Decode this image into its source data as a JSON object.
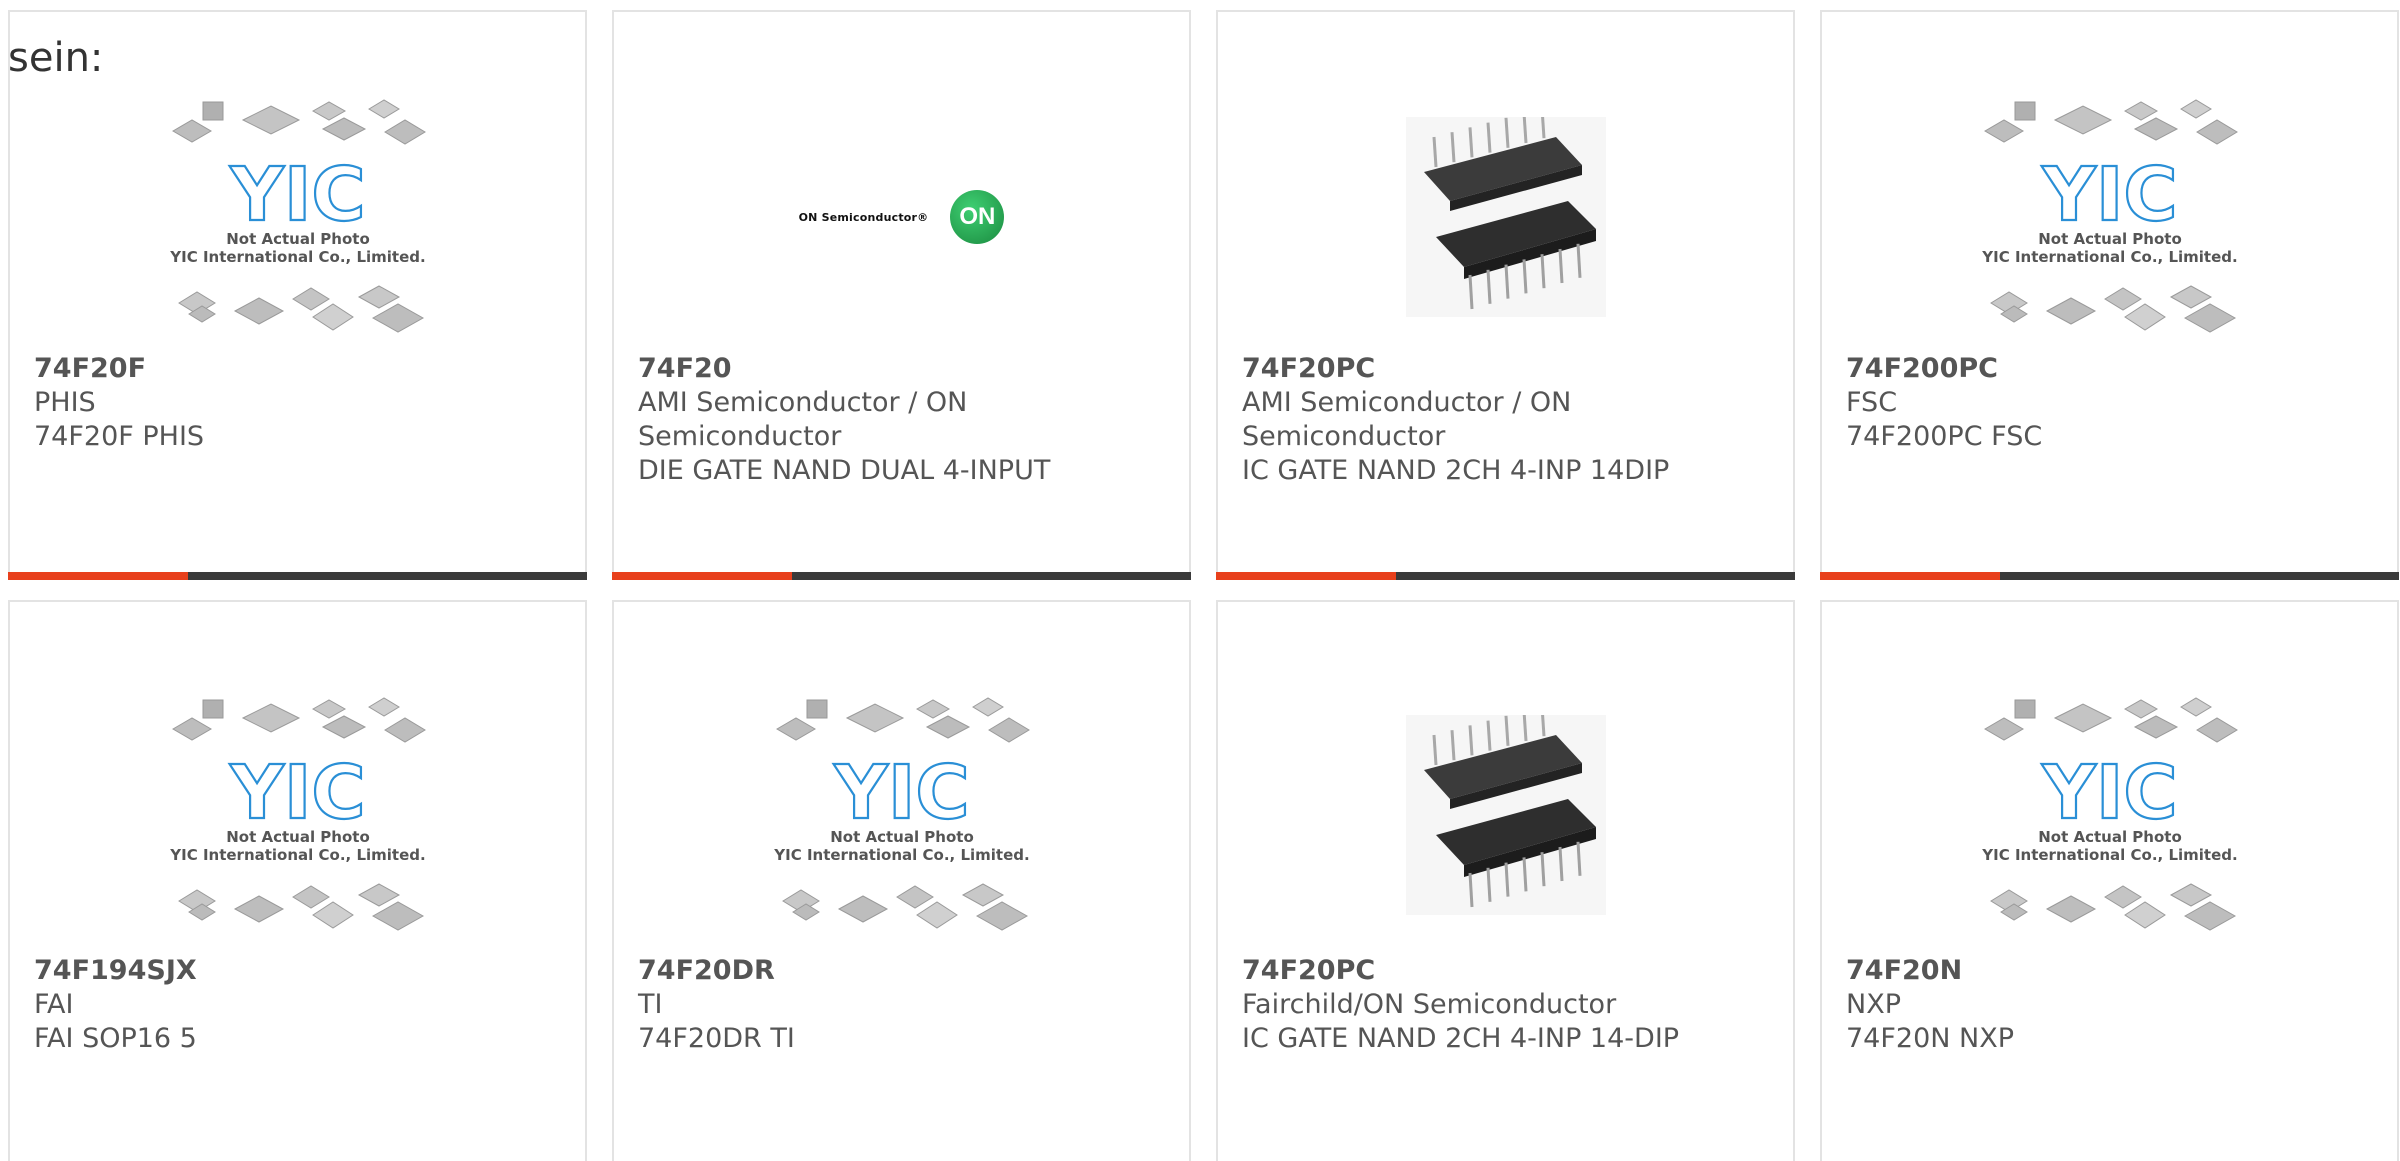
{
  "lead_text": "sein:",
  "accent_color": "#e8401c",
  "bar_color": "#3a3a3a",
  "cards": [
    {
      "part": "74F20F",
      "lines": [
        "PHIS",
        "74F20F PHIS"
      ],
      "image": "yic-placeholder",
      "placeholder": {
        "line1": "Not Actual Photo",
        "line2": "YIC International Co., Limited."
      }
    },
    {
      "part": "74F20",
      "lines": [
        "AMI Semiconductor / ON",
        "Semiconductor",
        "DIE GATE NAND DUAL 4-INPUT"
      ],
      "image": "on-semiconductor-logo",
      "logo": {
        "text": "ON Semiconductor®",
        "mark": "ON"
      }
    },
    {
      "part": "74F20PC",
      "lines": [
        "AMI Semiconductor / ON",
        "Semiconductor",
        "IC GATE NAND 2CH 4-INP 14DIP"
      ],
      "image": "dip-chip-photo"
    },
    {
      "part": "74F200PC",
      "lines": [
        "FSC",
        "74F200PC FSC"
      ],
      "image": "yic-placeholder",
      "placeholder": {
        "line1": "Not Actual Photo",
        "line2": "YIC International Co., Limited."
      }
    },
    {
      "part": "74F194SJX",
      "lines": [
        "FAI",
        "FAI SOP16 5"
      ],
      "image": "yic-placeholder",
      "placeholder": {
        "line1": "Not Actual Photo",
        "line2": "YIC International Co., Limited."
      }
    },
    {
      "part": "74F20DR",
      "lines": [
        "TI",
        "74F20DR TI"
      ],
      "image": "yic-placeholder",
      "placeholder": {
        "line1": "Not Actual Photo",
        "line2": "YIC International Co., Limited."
      }
    },
    {
      "part": "74F20PC",
      "lines": [
        "Fairchild/ON Semiconductor",
        "IC GATE NAND 2CH 4-INP 14-DIP"
      ],
      "image": "dip-chip-photo"
    },
    {
      "part": "74F20N",
      "lines": [
        "NXP",
        "74F20N NXP"
      ],
      "image": "yic-placeholder",
      "placeholder": {
        "line1": "Not Actual Photo",
        "line2": "YIC International Co., Limited."
      }
    }
  ]
}
